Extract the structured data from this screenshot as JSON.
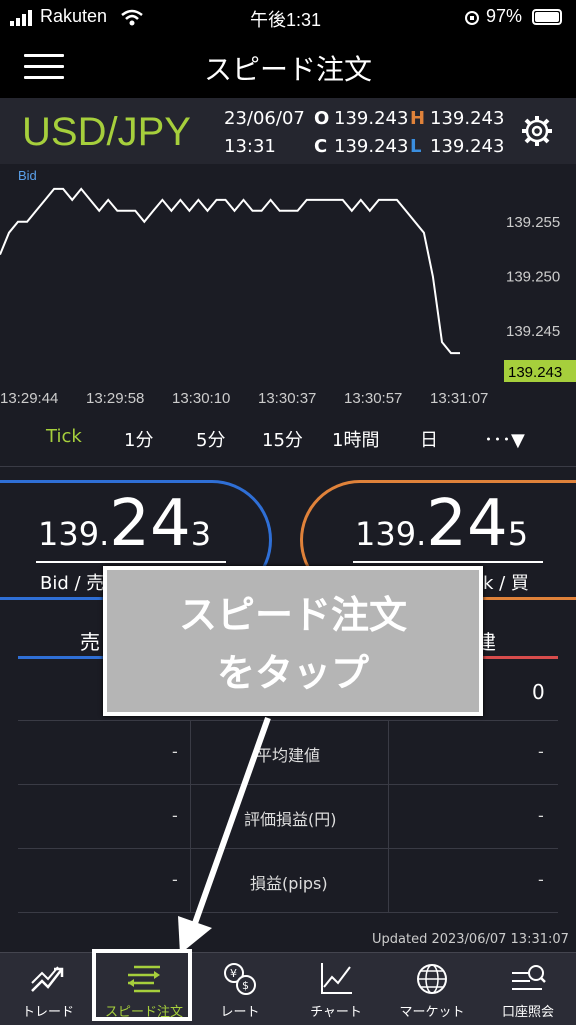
{
  "status_bar": {
    "carrier": "Rakuten",
    "time": "午後1:31",
    "battery": "97%"
  },
  "header": {
    "title": "スピード注文"
  },
  "instrument": {
    "pair": "USD/JPY",
    "date": "23/06/07",
    "time": "13:31",
    "open_label": "O",
    "open": "139.243",
    "high_label": "H",
    "high": "139.243",
    "close_label": "C",
    "close": "139.243",
    "low_label": "L",
    "low": "139.243"
  },
  "chart_data": {
    "type": "line",
    "series_label": "Bid",
    "x_ticks": [
      "13:29:44",
      "13:29:58",
      "13:30:10",
      "13:30:37",
      "13:30:57",
      "13:31:07"
    ],
    "y_ticks": [
      "139.255",
      "139.250",
      "139.245"
    ],
    "last_value": "139.243",
    "ylim": [
      139.242,
      139.259
    ],
    "values": [
      139.252,
      139.254,
      139.255,
      139.255,
      139.256,
      139.257,
      139.258,
      139.258,
      139.257,
      139.258,
      139.257,
      139.256,
      139.257,
      139.256,
      139.256,
      139.256,
      139.255,
      139.256,
      139.257,
      139.256,
      139.257,
      139.256,
      139.257,
      139.256,
      139.257,
      139.257,
      139.256,
      139.257,
      139.256,
      139.256,
      139.257,
      139.256,
      139.256,
      139.256,
      139.257,
      139.257,
      139.257,
      139.257,
      139.257,
      139.256,
      139.257,
      139.256,
      139.257,
      139.257,
      139.257,
      139.256,
      139.255,
      139.254,
      139.25,
      139.244,
      139.243,
      139.243
    ]
  },
  "tabs": [
    "Tick",
    "1分",
    "5分",
    "15分",
    "1時間",
    "日",
    "･･･▼"
  ],
  "bid": {
    "prefix": "139.",
    "big": "24",
    "suffix": "3",
    "label": "Bid / 売"
  },
  "ask": {
    "prefix": "139.",
    "big": "24",
    "suffix": "5",
    "label": "k / 買"
  },
  "order_labels": {
    "sell": "売",
    "buy": "建"
  },
  "table": {
    "qty_right": "0",
    "rows": [
      {
        "left": "-",
        "label": "平均建値",
        "right": "-"
      },
      {
        "left": "-",
        "label": "評価損益(円)",
        "right": "-"
      },
      {
        "left": "-",
        "label": "損益(pips)",
        "right": "-"
      }
    ],
    "updated": "Updated  2023/06/07  13:31:07"
  },
  "overlay": {
    "line1": "スピード注文",
    "line2": "をタップ"
  },
  "bottom_nav": [
    {
      "label": "トレード",
      "icon": "trade-chart-icon"
    },
    {
      "label": "スピード注文",
      "icon": "speed-order-icon"
    },
    {
      "label": "レート",
      "icon": "rate-currency-icon"
    },
    {
      "label": "チャート",
      "icon": "chart-icon"
    },
    {
      "label": "マーケット",
      "icon": "globe-icon"
    },
    {
      "label": "口座照会",
      "icon": "account-inquiry-icon"
    }
  ],
  "colors": {
    "accent_green": "#a6cf3c",
    "bid_blue": "#2f6fd6",
    "ask_orange": "#e0823a"
  }
}
